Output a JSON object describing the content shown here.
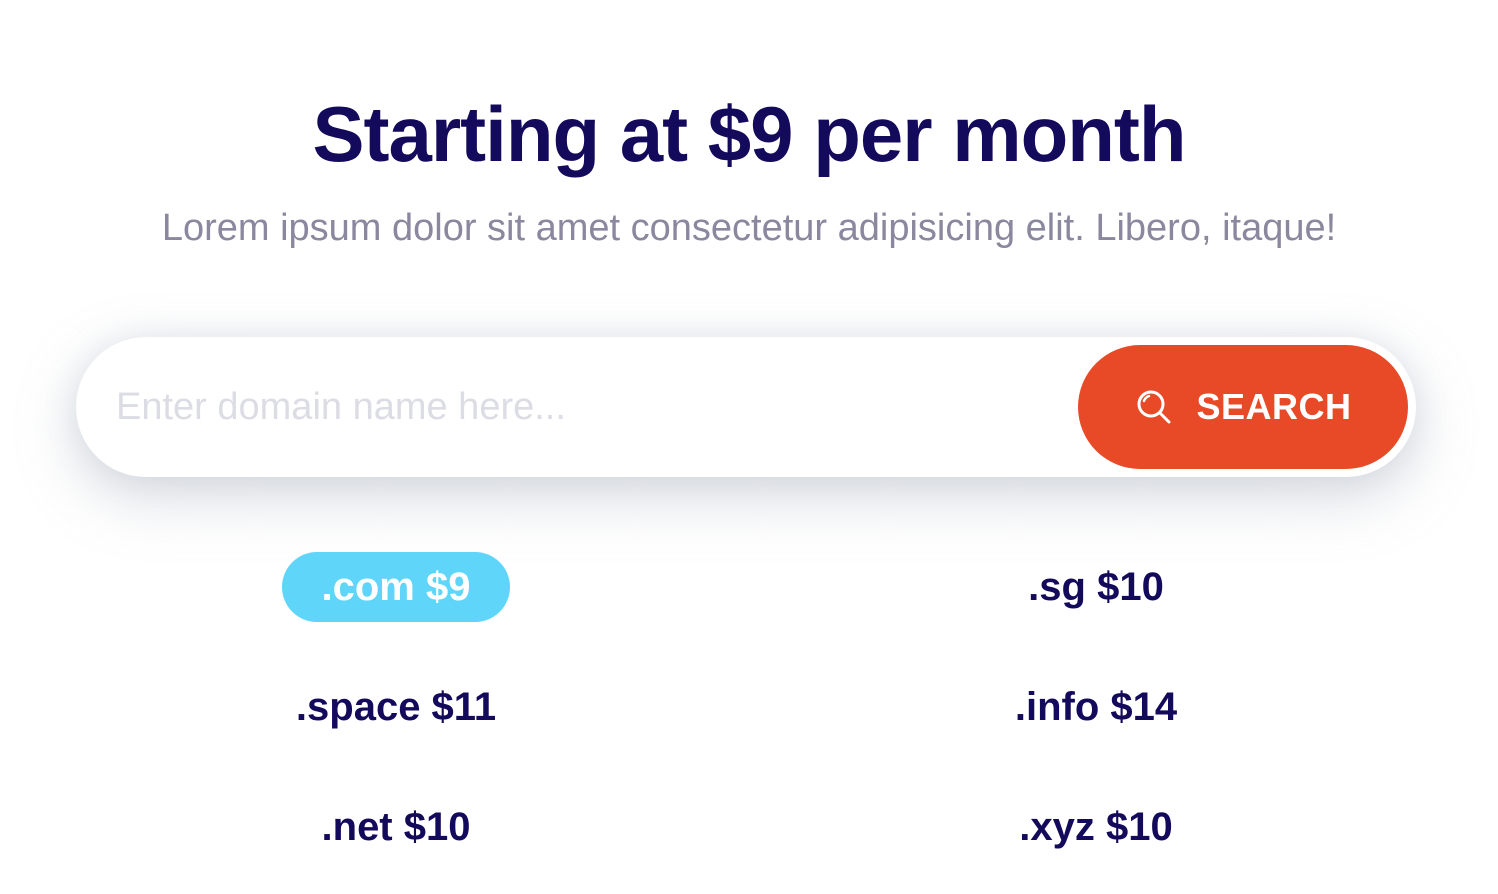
{
  "hero": {
    "title": "Starting at $9 per month",
    "subtitle": "Lorem ipsum dolor sit amet consectetur adipisicing elit. Libero, itaque!"
  },
  "search": {
    "placeholder": "Enter domain name here...",
    "value": "",
    "button_label": "SEARCH",
    "button_icon": "search-icon"
  },
  "domains": [
    {
      "label": ".com $9",
      "highlighted": true
    },
    {
      "label": ".sg $10",
      "highlighted": false
    },
    {
      "label": ".space $11",
      "highlighted": false
    },
    {
      "label": ".info $14",
      "highlighted": false
    },
    {
      "label": ".net $10",
      "highlighted": false
    },
    {
      "label": ".xyz $10",
      "highlighted": false
    }
  ],
  "colors": {
    "title": "#140a5b",
    "subtitle": "#8a879e",
    "button": "#e84a28",
    "highlight": "#5fd6f9"
  }
}
